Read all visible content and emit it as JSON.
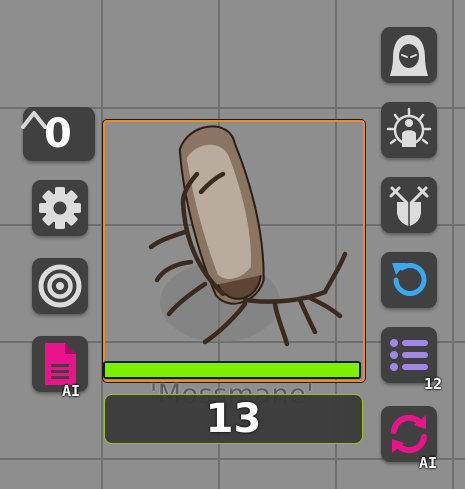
{
  "token": {
    "name": "'Mossmane'",
    "hit_points": "13",
    "health_fraction": 1.0,
    "border_color": "#f08b1c",
    "health_color": "#7cf000"
  },
  "left_toolbar": {
    "elevation": {
      "icon": "caret-up-icon",
      "value": "0"
    },
    "settings": {
      "icon": "gear-icon"
    },
    "target": {
      "icon": "target-icon"
    },
    "notes": {
      "icon": "document-icon",
      "badge": "AI"
    }
  },
  "right_toolbar": {
    "hood": {
      "icon": "hooded-figure-icon"
    },
    "aura": {
      "icon": "aura-figure-icon"
    },
    "combat": {
      "icon": "crossed-swords-shield-icon"
    },
    "undo": {
      "icon": "undo-icon"
    },
    "list": {
      "icon": "list-icon",
      "badge": "12"
    },
    "refresh": {
      "icon": "refresh-icon",
      "badge": "AI"
    }
  }
}
